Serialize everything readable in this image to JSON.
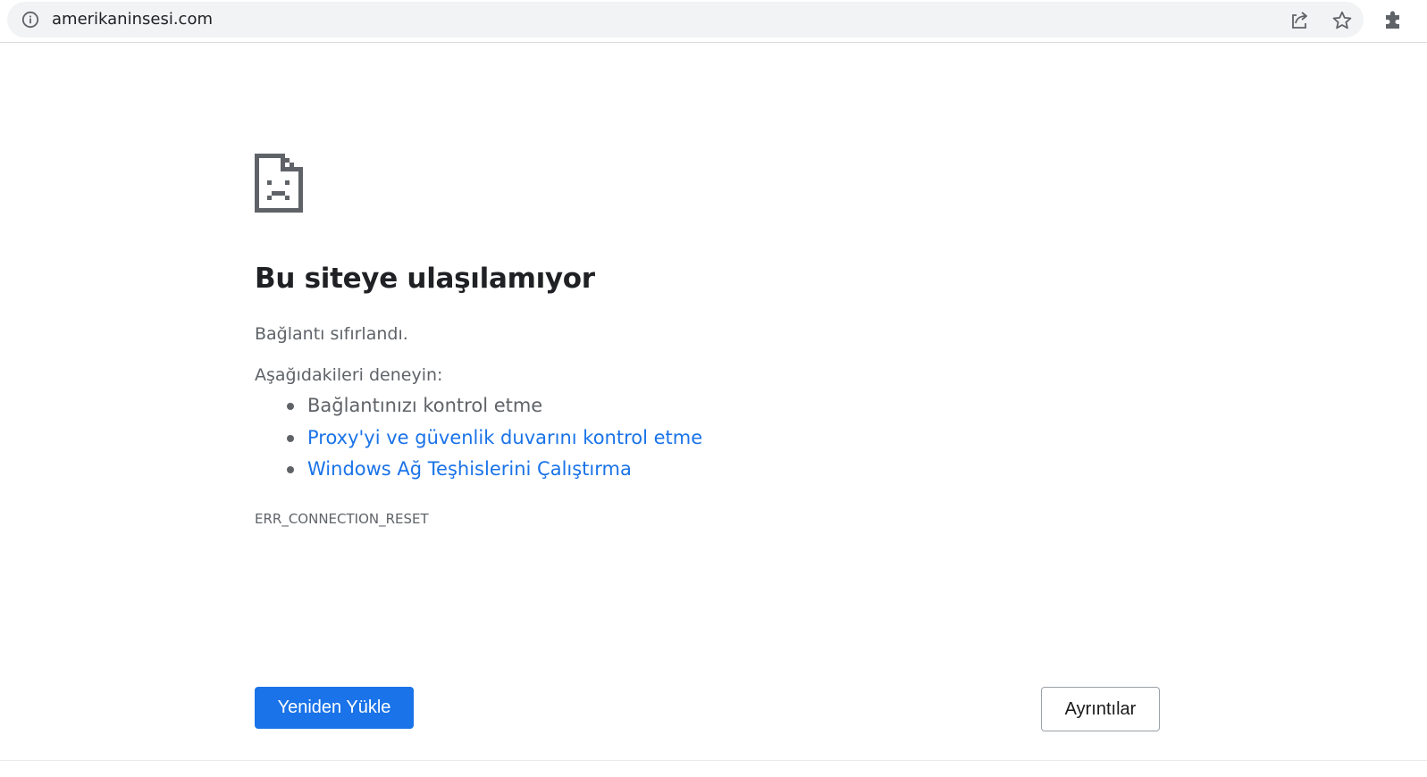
{
  "address_bar": {
    "url": "amerikaninsesi.com",
    "icons": [
      "info-icon",
      "share-icon",
      "bookmark-star-icon",
      "extensions-icon"
    ]
  },
  "error_page": {
    "icon": "sad-document-icon",
    "title": "Bu siteye ulaşılamıyor",
    "summary": "Bağlantı sıfırlandı.",
    "try_label": "Aşağıdakileri deneyin:",
    "suggestions": [
      "Bağlantınızı kontrol etme",
      "Proxy'yi ve güvenlik duvarını kontrol etme",
      "Windows Ağ Teşhislerini Çalıştırma"
    ],
    "error_code": "ERR_CONNECTION_RESET"
  },
  "buttons": {
    "reload_label": "Yeniden Yükle",
    "details_label": "Ayrıntılar"
  },
  "colors": {
    "link": "#1a73e8",
    "primary_button": "#1a73e8",
    "text_secondary": "#5f6368",
    "omnibox_bg": "#f1f3f4"
  }
}
